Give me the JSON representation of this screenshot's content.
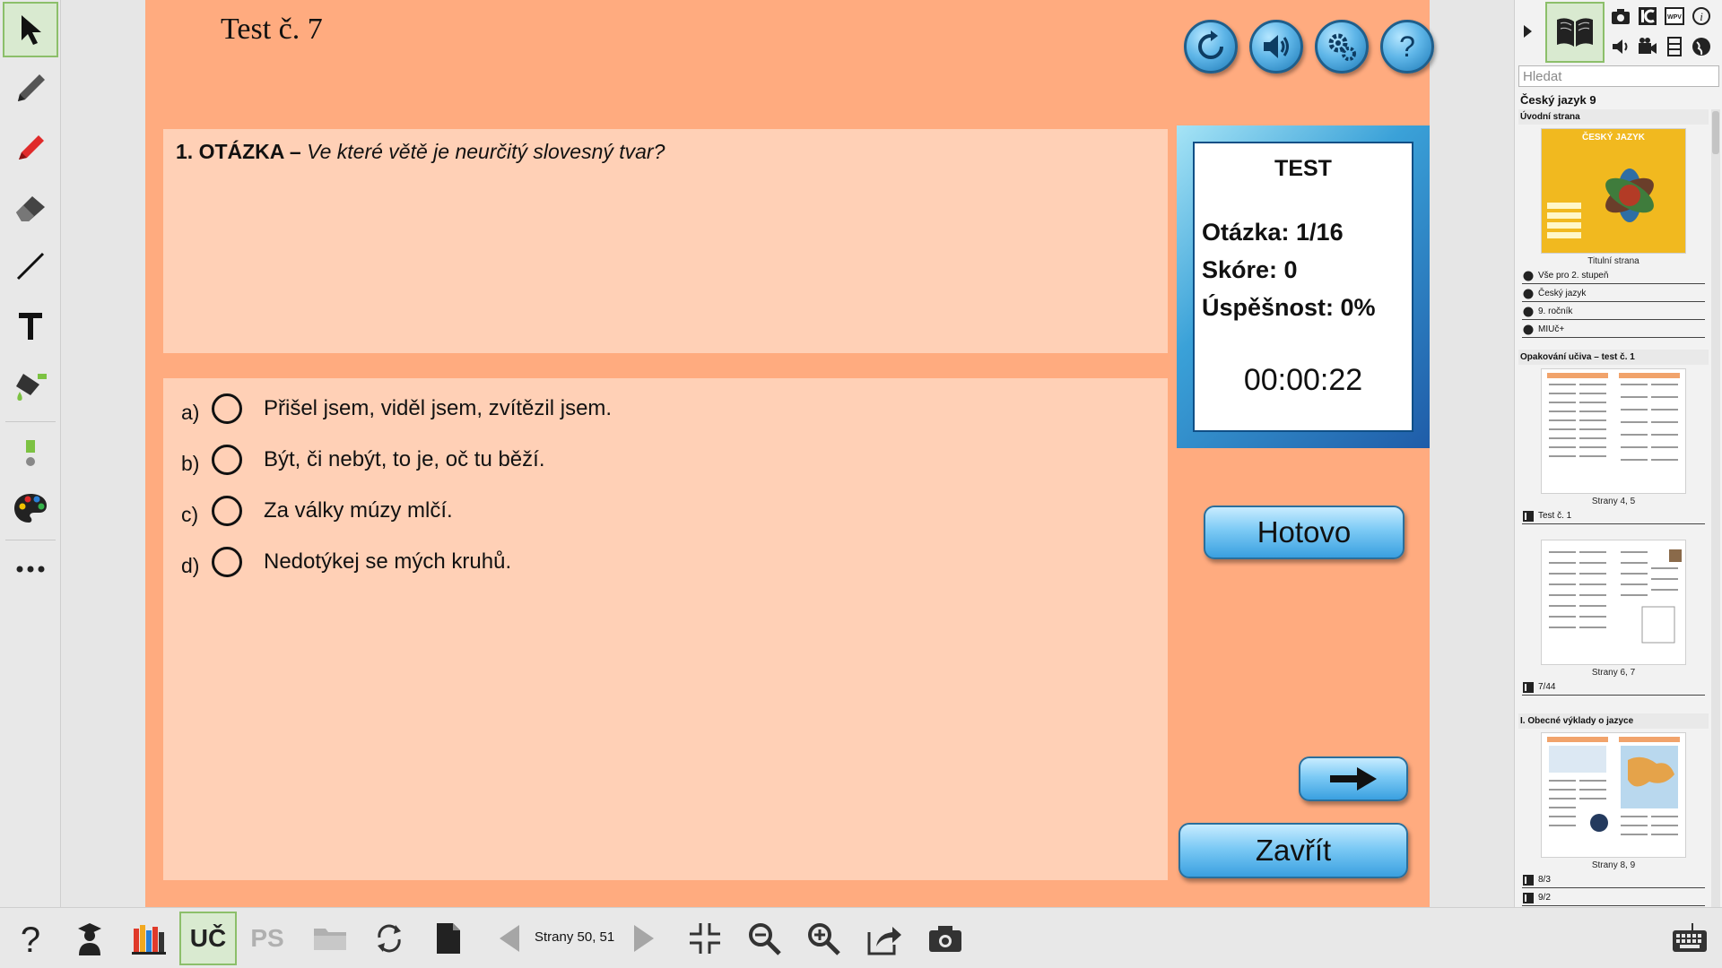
{
  "test": {
    "title": "Test č. 7",
    "question_number": "1. OTÁZKA –",
    "question_text": "Ve které větě je neurčitý slovesný tvar?",
    "answers": [
      {
        "letter": "a)",
        "text": "Přišel jsem, viděl jsem, zvítězil jsem."
      },
      {
        "letter": "b)",
        "text": "Být, či nebýt, to je, oč tu běží."
      },
      {
        "letter": "c)",
        "text": "Za války múzy mlčí."
      },
      {
        "letter": "d)",
        "text": "Nedotýkej se mých kruhů."
      }
    ],
    "score": {
      "heading": "TEST",
      "question_progress": "Otázka: 1/16",
      "score": "Skóre: 0",
      "success": "Úspěšnost: 0%",
      "timer": "00:00:22"
    },
    "done_label": "Hotovo",
    "close_label": "Zavřít",
    "top_buttons": [
      "reload-icon",
      "sound-icon",
      "settings-icon",
      "help-icon"
    ]
  },
  "left_toolbar": {
    "tools": [
      "select-icon",
      "pencil-icon",
      "marker-icon",
      "eraser-icon",
      "line-icon",
      "text-icon",
      "fill-icon",
      "size-icon",
      "palette-icon",
      "more-icon"
    ]
  },
  "right_panel": {
    "search_placeholder": "Hledat",
    "book_title": "Český jazyk 9",
    "sections": [
      {
        "header": "Úvodní strana",
        "caption": "Titulní strana",
        "thumb_heading": "ČESKÝ JAZYK",
        "links": [
          "Vše pro 2. stupeň",
          "Český jazyk",
          "9. ročník",
          "MIUč+"
        ]
      },
      {
        "header": "Opakování učiva – test č. 1",
        "caption": "Strany 4, 5",
        "links": [
          "Test č. 1"
        ]
      },
      {
        "header": "",
        "caption": "Strany 6, 7",
        "links": [
          "7/44"
        ]
      },
      {
        "header": "I. Obecné výklady o jazyce",
        "caption": "Strany 8, 9",
        "links": [
          "8/3",
          "9/2"
        ]
      }
    ]
  },
  "bottom_toolbar": {
    "uc_label": "UČ",
    "ps_label": "PS",
    "pages_label": "Strany 50, 51"
  },
  "colors": {
    "background_orange": "#ffab7f",
    "panel_peach": "#ffd0b6",
    "button_blue": "#5fb6e8",
    "active_green": "#d9ead0"
  }
}
